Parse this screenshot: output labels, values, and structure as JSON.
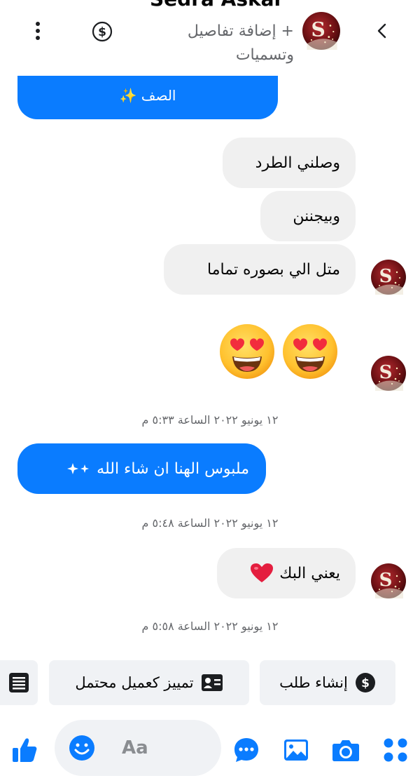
{
  "header": {
    "contact_name": "Sedra Askar",
    "add_details": "+ إضافة تفاصيل وتسميات"
  },
  "messages": {
    "top_partial": "الصف ✨",
    "m1": "وصلني الطرد",
    "m2": "وبيجننن",
    "m3": "متل الي بصوره تماما",
    "emoji": "😍😍",
    "ts1": "١٢ يونيو ٢٠٢٢ الساعة ٥:٣٣ م",
    "m4": "ملبوس الهنا ان شاء الله",
    "ts2": "١٢ يونيو ٢٠٢٢ الساعة ٥:٤٨ م",
    "m5": "يعني البك",
    "ts3": "١٢ يونيو ٢٠٢٢ الساعة ٥:٥٨ م"
  },
  "quick_actions": {
    "create_order": "إنشاء طلب",
    "mark_potential": "تمييز كعميل محتمل"
  },
  "composer": {
    "placeholder": "Aa"
  },
  "colors": {
    "accent": "#0a7cff",
    "incoming_bubble": "#f0f0f0",
    "muted_text": "#65676b",
    "avatar_bg": "#5a0f12",
    "heart": "#e41e3f"
  },
  "icons": [
    "chevron-left-icon",
    "dollar-icon",
    "more-vertical-icon",
    "sparkle-icon",
    "heart-icon",
    "id-card-icon",
    "list-icon",
    "thumbs-up-icon",
    "emoji-icon",
    "chat-bubble-icon",
    "image-icon",
    "camera-icon",
    "apps-grid-icon"
  ]
}
